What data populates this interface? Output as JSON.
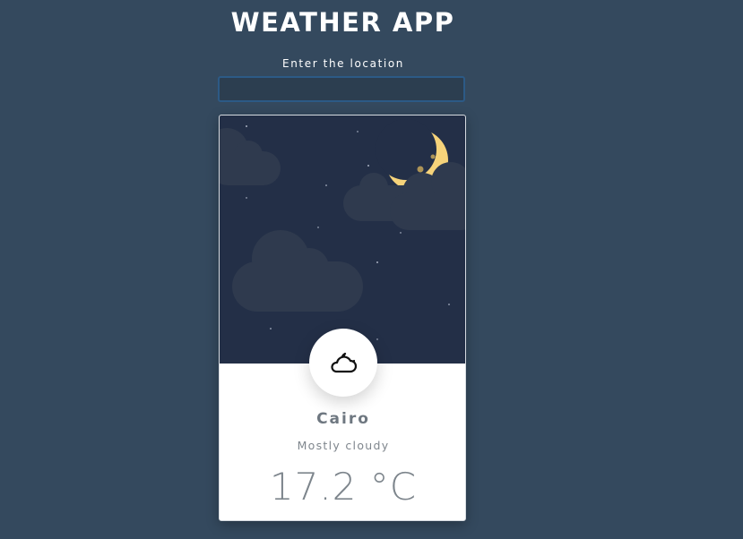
{
  "header": {
    "title": "WEATHER APP"
  },
  "search": {
    "label": "Enter the location",
    "value": "",
    "placeholder": ""
  },
  "weather": {
    "city": "Cairo",
    "condition": "Mostly cloudy",
    "temperature": "17.2 °C",
    "condition_icon": "cloud-moon-icon",
    "scene": "night-sky-moon-clouds"
  },
  "colors": {
    "background": "#34495e",
    "sky": "#232f47",
    "cloud": "#2f3a4e",
    "moon": "#f6d37a",
    "card": "#ffffff",
    "text_muted": "#6e7780"
  }
}
